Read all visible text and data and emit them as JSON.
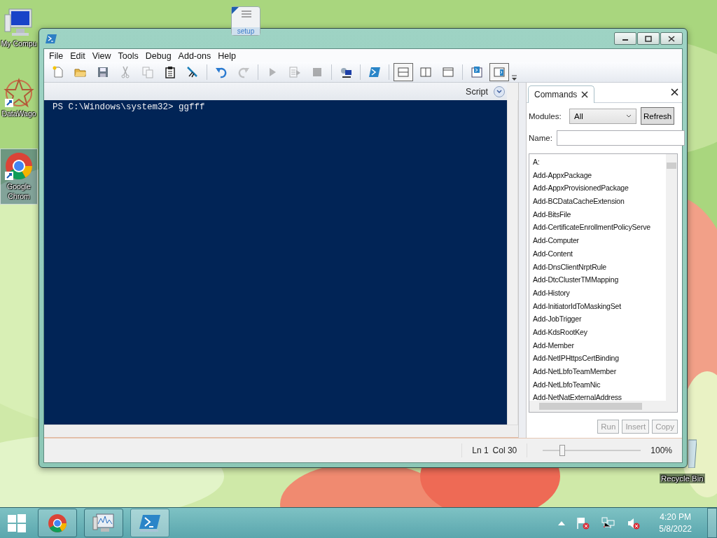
{
  "desktop": {
    "icons": [
      {
        "kind": "computer",
        "label": "My Compu",
        "selected": false
      },
      {
        "kind": "datawagon",
        "label": "DataWago",
        "selected": false
      },
      {
        "kind": "chrome",
        "label": "Google Chrom",
        "selected": true
      }
    ],
    "setup_icon": {
      "icon_text": "setup"
    },
    "recycle_bin": {
      "label": "Recycle Bin"
    }
  },
  "window": {
    "menu": [
      "File",
      "Edit",
      "View",
      "Tools",
      "Debug",
      "Add-ons",
      "Help"
    ],
    "toolbar": [
      {
        "kind": "new",
        "disabled": false,
        "selected": false
      },
      {
        "kind": "open",
        "disabled": false,
        "selected": false
      },
      {
        "kind": "save",
        "disabled": false,
        "selected": false
      },
      {
        "kind": "cut",
        "disabled": true,
        "selected": false
      },
      {
        "kind": "copy",
        "disabled": true,
        "selected": false
      },
      {
        "kind": "paste",
        "disabled": false,
        "selected": false
      },
      {
        "kind": "clear",
        "disabled": false,
        "selected": false
      },
      {
        "kind": "separator"
      },
      {
        "kind": "undo",
        "disabled": false,
        "selected": false
      },
      {
        "kind": "redo",
        "disabled": true,
        "selected": false
      },
      {
        "kind": "separator"
      },
      {
        "kind": "run",
        "disabled": true,
        "selected": false
      },
      {
        "kind": "run-selection",
        "disabled": true,
        "selected": false
      },
      {
        "kind": "stop",
        "disabled": true,
        "selected": false
      },
      {
        "kind": "separator"
      },
      {
        "kind": "remote",
        "disabled": false,
        "selected": false
      },
      {
        "kind": "separator"
      },
      {
        "kind": "powershell",
        "disabled": false,
        "selected": false
      },
      {
        "kind": "separator"
      },
      {
        "kind": "layout-top",
        "disabled": false,
        "selected": true
      },
      {
        "kind": "layout-right",
        "disabled": false,
        "selected": false
      },
      {
        "kind": "layout-max",
        "disabled": false,
        "selected": false
      },
      {
        "kind": "separator"
      },
      {
        "kind": "show-script",
        "disabled": false,
        "selected": false
      },
      {
        "kind": "show-commands",
        "disabled": false,
        "selected": true
      }
    ],
    "script_pane": {
      "label": "Script"
    },
    "console": {
      "lines": [
        "PS C:\\Windows\\system32> ggfff"
      ]
    },
    "commands": {
      "tab": "Commands",
      "modules_label": "Modules:",
      "modules_value": "All",
      "refresh": "Refresh",
      "name_label": "Name:",
      "items": [
        "A:",
        "Add-AppxPackage",
        "Add-AppxProvisionedPackage",
        "Add-BCDataCacheExtension",
        "Add-BitsFile",
        "Add-CertificateEnrollmentPolicyServe",
        "Add-Computer",
        "Add-Content",
        "Add-DnsClientNrptRule",
        "Add-DtcClusterTMMapping",
        "Add-History",
        "Add-InitiatorIdToMaskingSet",
        "Add-JobTrigger",
        "Add-KdsRootKey",
        "Add-Member",
        "Add-NetIPHttpsCertBinding",
        "Add-NetLbfoTeamMember",
        "Add-NetLbfoTeamNic",
        "Add-NetNatExternalAddress"
      ],
      "buttons": [
        {
          "label": "Run",
          "disabled": true
        },
        {
          "label": "Insert",
          "disabled": true
        },
        {
          "label": "Copy",
          "disabled": true
        }
      ]
    },
    "status_bar": {
      "line": "Ln 1",
      "column": "Col 30",
      "zoom": {
        "level": 0.2
      },
      "zoom_reading": "100%"
    }
  },
  "taskbar": {
    "apps": [
      {
        "kind": "chrome",
        "selected": false
      },
      {
        "kind": "monitor",
        "selected": false
      },
      {
        "kind": "powershell",
        "selected": true
      }
    ],
    "clock": {
      "time": "4:20 PM",
      "date": "5/8/2022"
    }
  }
}
